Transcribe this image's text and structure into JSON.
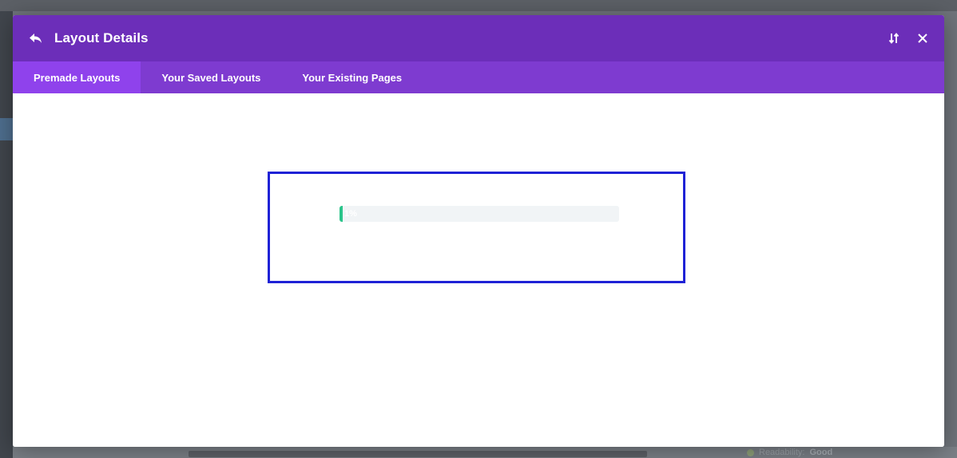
{
  "background": {
    "readability_label": "Readability:",
    "readability_value": "Good"
  },
  "modal": {
    "title": "Layout Details",
    "back_icon": "undo-arrow-icon",
    "sort_icon": "sort-arrows-icon",
    "close_icon": "close-icon",
    "colors": {
      "header": "#6c2eb9",
      "tabs": "#7e3bd0",
      "active_tab": "#8f42ec",
      "progress_fill": "#2bc48a",
      "highlight_border": "#1f22d6"
    }
  },
  "tabs": [
    {
      "label": "Premade Layouts",
      "active": true
    },
    {
      "label": "Your Saved Layouts",
      "active": false
    },
    {
      "label": "Your Existing Pages",
      "active": false
    }
  ],
  "loader": {
    "progress_percent": 1,
    "progress_text": "1%"
  }
}
